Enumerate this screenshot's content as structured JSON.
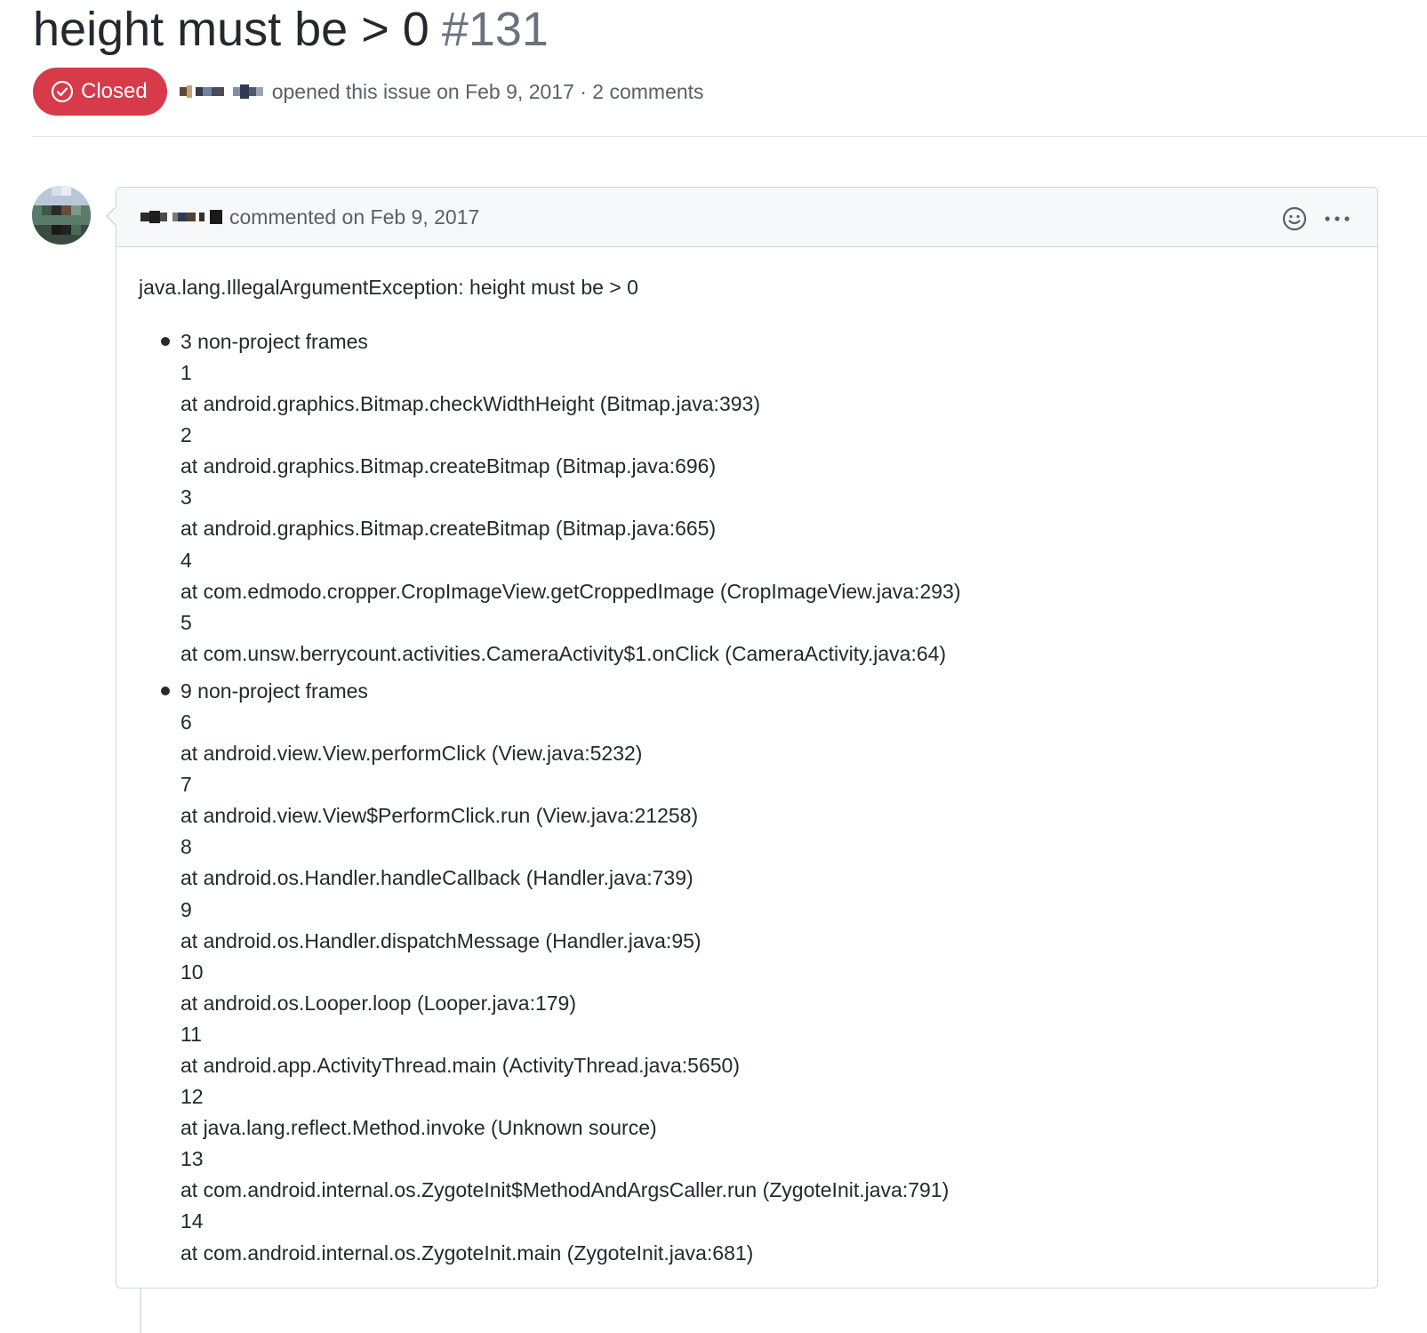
{
  "issue": {
    "title": "height must be > 0",
    "number": "#131",
    "state_label": "Closed",
    "opened_text": "opened this issue on Feb 9, 2017 · 2 comments"
  },
  "comment": {
    "meta_text": "commented on Feb 9, 2017",
    "exception": "java.lang.IllegalArgumentException: height must be > 0",
    "groups": [
      {
        "title": "3 non-project frames",
        "frames": [
          {
            "n": "1",
            "text": "at android.graphics.Bitmap.checkWidthHeight (Bitmap.java:393)"
          },
          {
            "n": "2",
            "text": "at android.graphics.Bitmap.createBitmap (Bitmap.java:696)"
          },
          {
            "n": "3",
            "text": "at android.graphics.Bitmap.createBitmap (Bitmap.java:665)"
          },
          {
            "n": "4",
            "text": "at com.edmodo.cropper.CropImageView.getCroppedImage (CropImageView.java:293)"
          },
          {
            "n": "5",
            "text": "at com.unsw.berrycount.activities.CameraActivity$1.onClick (CameraActivity.java:64)"
          }
        ]
      },
      {
        "title": "9 non-project frames",
        "frames": [
          {
            "n": "6",
            "text": "at android.view.View.performClick (View.java:5232)"
          },
          {
            "n": "7",
            "text": "at android.view.View$PerformClick.run (View.java:21258)"
          },
          {
            "n": "8",
            "text": "at android.os.Handler.handleCallback (Handler.java:739)"
          },
          {
            "n": "9",
            "text": "at android.os.Handler.dispatchMessage (Handler.java:95)"
          },
          {
            "n": "10",
            "text": "at android.os.Looper.loop (Looper.java:179)"
          },
          {
            "n": "11",
            "text": "at android.app.ActivityThread.main (ActivityThread.java:5650)"
          },
          {
            "n": "12",
            "text": "at java.lang.reflect.Method.invoke (Unknown source)"
          },
          {
            "n": "13",
            "text": "at com.android.internal.os.ZygoteInit$MethodAndArgsCaller.run (ZygoteInit.java:791)"
          },
          {
            "n": "14",
            "text": "at com.android.internal.os.ZygoteInit.main (ZygoteInit.java:681)"
          }
        ]
      }
    ]
  },
  "icons": {
    "state": "check-circle-icon",
    "reaction": "smiley-icon",
    "more": "kebab-horizontal-icon"
  },
  "colors": {
    "closed_badge": "#d73a49",
    "text": "#24292e",
    "muted": "#586069",
    "header_bg": "#f6f8fa",
    "border": "#d1d5da"
  }
}
